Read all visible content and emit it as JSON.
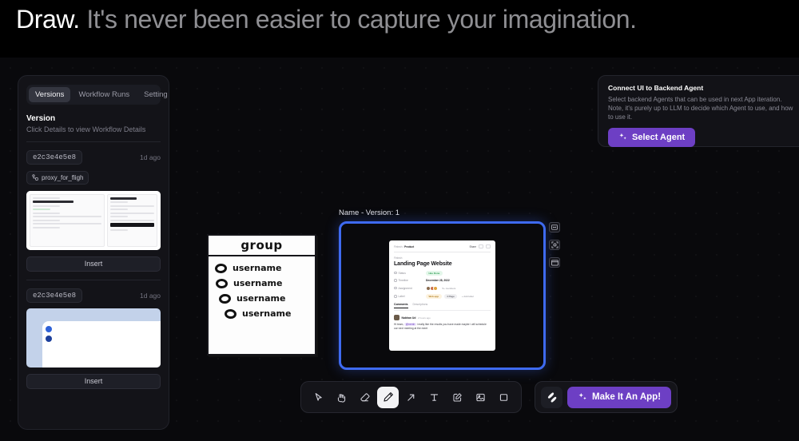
{
  "headline": {
    "strong": "Draw.",
    "rest": "It's never been easier to capture your imagination."
  },
  "sidebar": {
    "tabs": [
      {
        "label": "Versions",
        "active": true
      },
      {
        "label": "Workflow Runs",
        "active": false
      },
      {
        "label": "Setting",
        "active": false
      }
    ],
    "section_title": "Version",
    "section_subtitle": "Click Details to view Workflow Details",
    "versions": [
      {
        "hash": "e2c3e4e5e8",
        "ago": "1d ago",
        "tag": "proxy_for_fligh",
        "insert_label": "Insert"
      },
      {
        "hash": "e2c3e4e5e8",
        "ago": "1d ago",
        "tag": "",
        "insert_label": "Insert"
      }
    ]
  },
  "agent_panel": {
    "title": "Connect UI to Backend Agent",
    "description": "Select backend Agents that can be used in next App iteration. Note, it's purely up to LLM to decide which Agent to use, and how to use it.",
    "button_label": "Select Agent"
  },
  "canvas": {
    "sketch": {
      "title": "group",
      "rows": [
        "username",
        "username",
        "username",
        "username"
      ]
    },
    "selected": {
      "label": "Name - Version: 1",
      "border_color": "#3e6af0",
      "preview": {
        "breadcrumb_parent": "Fintech",
        "breadcrumb_current": "Product",
        "share_label": "Share",
        "kicker": "Fintech",
        "title": "Landing Page Website",
        "meta": [
          {
            "key": "Status",
            "value": "Has Done",
            "kind": "pill-green"
          },
          {
            "key": "Timeline",
            "value": "December 28, 2022",
            "kind": "text"
          },
          {
            "key": "Assignment",
            "value": "5+ members",
            "kind": "avatars"
          },
          {
            "key": "Label",
            "value": "Web-app",
            "value2": "4 Page",
            "value3": "+ Add label",
            "kind": "labels"
          }
        ],
        "tabs": [
          {
            "label": "Comments",
            "active": true
          },
          {
            "label": "Descriptions",
            "active": false
          }
        ],
        "comment": {
          "author": "Nabhan Ud",
          "time": "2 hours ago",
          "text_before": "Hi team,",
          "mention": "@nemh",
          "text_after": "i really like the results you have made maybe i will schedule our next meeting at the meet"
        }
      }
    }
  },
  "side_tools": [
    {
      "icon": "frame-resize-icon"
    },
    {
      "icon": "fit-to-screen-icon"
    },
    {
      "icon": "browser-frame-icon"
    }
  ],
  "toolbar": {
    "tools": [
      {
        "icon": "cursor-select-icon",
        "active": false
      },
      {
        "icon": "hand-pan-icon",
        "active": false
      },
      {
        "icon": "eraser-icon",
        "active": false
      },
      {
        "icon": "pencil-icon",
        "active": true
      },
      {
        "icon": "arrow-icon",
        "active": false
      },
      {
        "icon": "text-icon",
        "active": false
      },
      {
        "icon": "note-edit-icon",
        "active": false
      },
      {
        "icon": "image-icon",
        "active": false
      },
      {
        "icon": "rectangle-icon",
        "active": false
      }
    ]
  },
  "cta": {
    "brand_icon": "brand-logo-icon",
    "make_app_label": "Make It An App!",
    "accent": "#6d3fc4"
  }
}
